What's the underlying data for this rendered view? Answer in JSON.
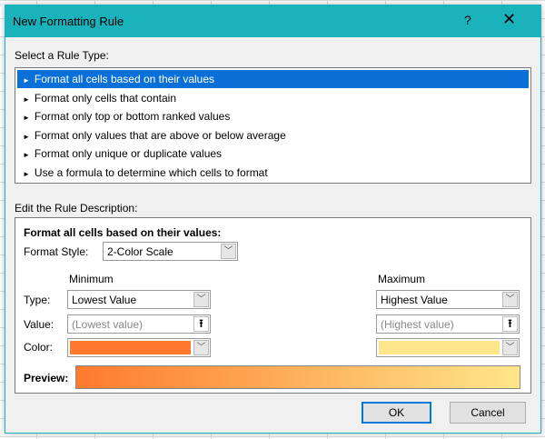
{
  "dialog": {
    "title": "New Formatting Rule",
    "help": "?",
    "close": "✕"
  },
  "rule_type": {
    "label": "Select a Rule Type:",
    "items": [
      "Format all cells based on their values",
      "Format only cells that contain",
      "Format only top or bottom ranked values",
      "Format only values that are above or below average",
      "Format only unique or duplicate values",
      "Use a formula to determine which cells to format"
    ],
    "selected": 0,
    "bullet": "►"
  },
  "description": {
    "label": "Edit the Rule Description:",
    "heading": "Format all cells based on their values:",
    "format_style_label": "Format Style:",
    "format_style_value": "2-Color Scale",
    "type_label": "Type:",
    "value_label": "Value:",
    "color_label": "Color:",
    "minimum": {
      "label": "Minimum",
      "type": "Lowest Value",
      "value_placeholder": "(Lowest value)",
      "color": "#ff7a2e"
    },
    "maximum": {
      "label": "Maximum",
      "type": "Highest Value",
      "value_placeholder": "(Highest value)",
      "color": "#ffe68a"
    },
    "preview_label": "Preview:"
  },
  "buttons": {
    "ok": "OK",
    "cancel": "Cancel"
  }
}
